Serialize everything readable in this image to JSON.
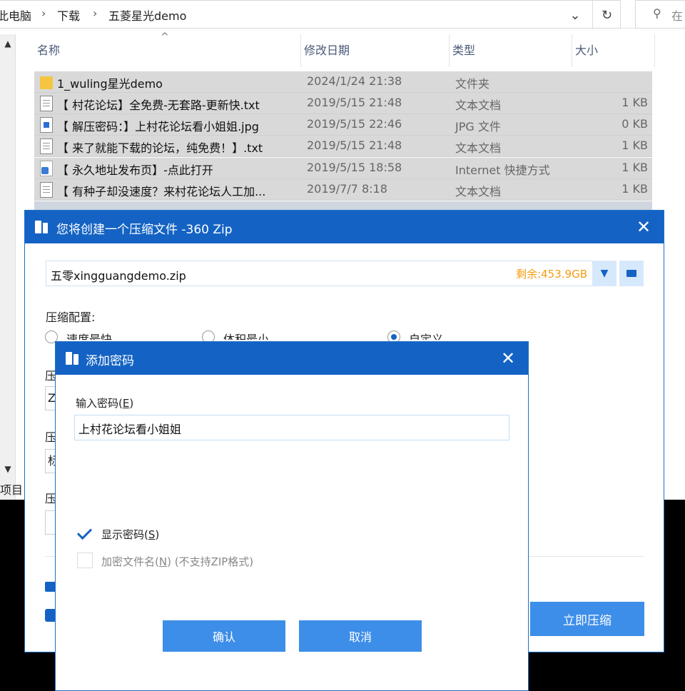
{
  "explorer": {
    "breadcrumb": [
      "此电脑",
      "下载",
      "五菱星光demo"
    ],
    "columns": {
      "name": "名称",
      "date": "修改日期",
      "type": "类型",
      "size": "大小"
    },
    "files": [
      {
        "name": "1_wuling星光demo",
        "date": "2024/1/24 21:38",
        "type": "文件夹",
        "size": "",
        "icon": "folder-icon"
      },
      {
        "name": "【 村花论坛】全免费-无套路-更新快.txt",
        "date": "2019/5/15 21:48",
        "type": "文本文档",
        "size": "1 KB",
        "icon": "text-file-icon"
      },
      {
        "name": "【 解压密码：】上村花论坛看小姐姐.jpg",
        "date": "2019/5/15 22:46",
        "type": "JPG 文件",
        "size": "0 KB",
        "icon": "image-file-icon"
      },
      {
        "name": "【 来了就能下载的论坛，纯免费！】.txt",
        "date": "2019/5/15 21:48",
        "type": "文本文档",
        "size": "1 KB",
        "icon": "text-file-icon"
      },
      {
        "name": "【 永久地址发布页】-点此打开",
        "date": "2019/5/15 18:58",
        "type": "Internet 快捷方式",
        "size": "1 KB",
        "icon": "shortcut-icon"
      },
      {
        "name": "【 有种子却没速度？来村花论坛人工加...",
        "date": "2019/7/7 8:18",
        "type": "文本文档",
        "size": "1 KB",
        "icon": "text-file-icon"
      }
    ],
    "left_label": "项目"
  },
  "compress_dialog": {
    "title": "您将创建一个压缩文件 -360 Zip",
    "filename": "五零xingguangdemo.zip",
    "free_space": "剩余:453.9GB",
    "config_label": "压缩配置:",
    "options": [
      "速度最快",
      "体积最小",
      "自定义"
    ],
    "selected_option": "自定义",
    "partial_labels": [
      "压",
      "压",
      "压"
    ],
    "partial_fields": [
      "Z",
      "标"
    ],
    "start_button": "立即压缩"
  },
  "password_dialog": {
    "title": "添加密码",
    "input_label": "输入密码(",
    "input_label_key": "E",
    "input_label_end": ")",
    "password_value": "上村花论坛看小姐姐",
    "show_password_label": "显示密码(",
    "show_password_key": "S",
    "show_password_end": ")",
    "show_password_checked": true,
    "encrypt_names_label": "加密文件名(",
    "encrypt_names_key": "N",
    "encrypt_names_end": ") (不支持ZIP格式)",
    "encrypt_names_checked": false,
    "ok_button": "确认",
    "cancel_button": "取消"
  },
  "colors": {
    "title_bar": "#1463c4",
    "primary_button": "#3d8ee8",
    "free_space": "#f39c12",
    "selection": "#d9d9d9"
  }
}
